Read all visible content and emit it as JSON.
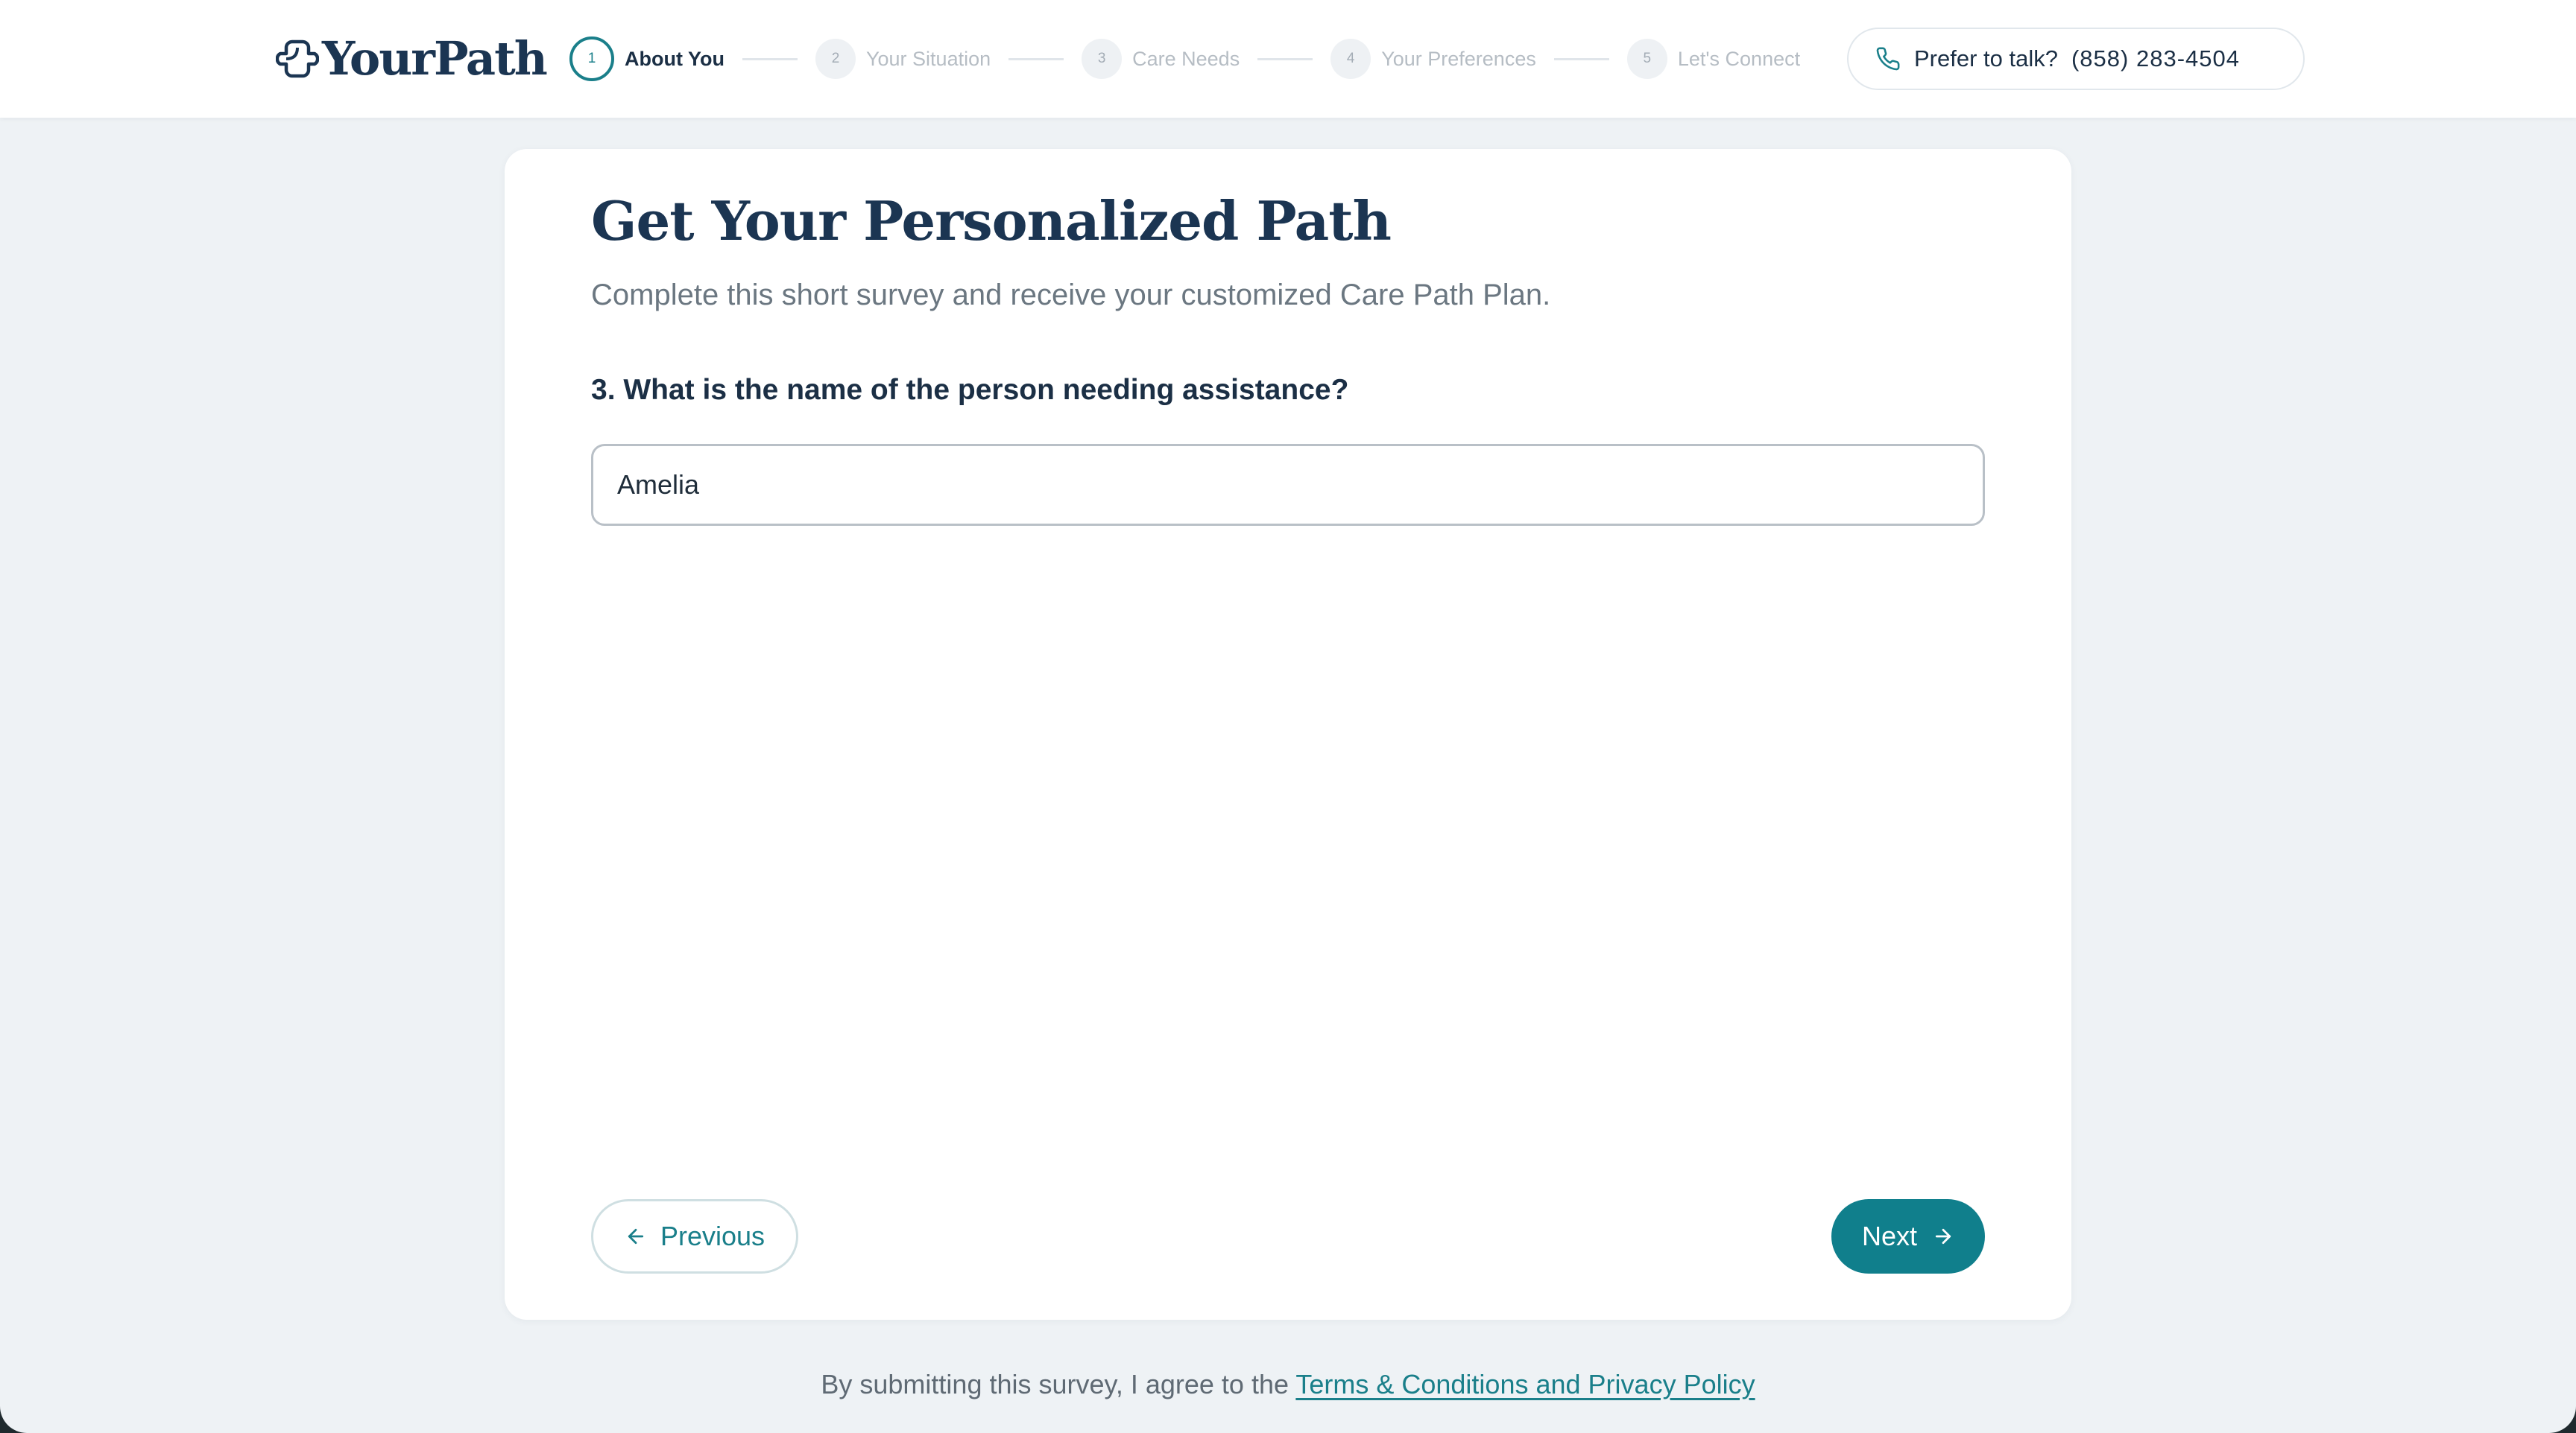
{
  "brand": {
    "name": "YourPath",
    "accent_color": "#107f8c",
    "navy_color": "#1b3552"
  },
  "stepper": {
    "steps": [
      {
        "number": "1",
        "label": "About You",
        "state": "active"
      },
      {
        "number": "2",
        "label": "Your Situation",
        "state": "inactive"
      },
      {
        "number": "3",
        "label": "Care Needs",
        "state": "inactive"
      },
      {
        "number": "4",
        "label": "Your Preferences",
        "state": "inactive"
      },
      {
        "number": "5",
        "label": "Let's Connect",
        "state": "inactive"
      }
    ]
  },
  "contact": {
    "label": "Prefer to talk?",
    "phone": "(858) 283-4504",
    "icon": "phone-icon"
  },
  "survey": {
    "title": "Get Your Personalized Path",
    "subtitle": "Complete this short survey and receive your customized Care Path Plan.",
    "question": "3. What is the name of the person needing assistance?",
    "answer_value": "Amelia"
  },
  "nav_buttons": {
    "previous_label": "Previous",
    "previous_icon": "arrow-left-icon",
    "next_label": "Next",
    "next_icon": "arrow-right-icon"
  },
  "footer": {
    "agreement_text": "By submitting this survey, I agree to the ",
    "terms_link": "Terms & Conditions and Privacy Policy"
  }
}
